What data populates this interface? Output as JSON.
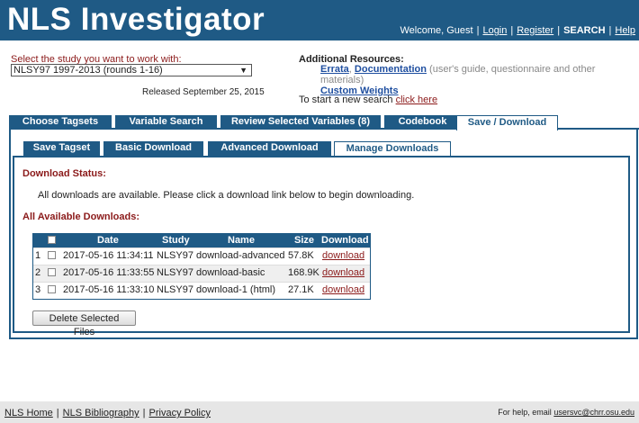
{
  "header": {
    "logo": "NLS Investigator",
    "welcome": "Welcome, Guest",
    "links": {
      "login": "Login",
      "register": "Register",
      "search": "SEARCH",
      "help": "Help"
    }
  },
  "study": {
    "label": "Select the study you want to work with:",
    "selected": "NLSY97 1997-2013 (rounds 1-16)",
    "released": "Released September 25, 2015"
  },
  "resources": {
    "title": "Additional Resources:",
    "errata": "Errata",
    "documentation": "Documentation",
    "doc_note": "(user's guide, questionnaire and other materials)",
    "custom_weights": "Custom Weights",
    "new_search_text": "To start a new search ",
    "new_search_link": "click here"
  },
  "tabs": [
    "Choose Tagsets",
    "Variable Search",
    "Review Selected Variables (8)",
    "Codebook",
    "Save / Download"
  ],
  "subtabs": [
    "Save Tagset",
    "Basic Download",
    "Advanced Download",
    "Manage Downloads"
  ],
  "status": {
    "heading": "Download Status:",
    "message": "All downloads are available. Please click a download link below to begin downloading.",
    "all_heading": "All Available Downloads:"
  },
  "table": {
    "headers": {
      "date": "Date",
      "study": "Study",
      "name": "Name",
      "size": "Size",
      "download": "Download"
    },
    "rows": [
      {
        "num": "1",
        "date": "2017-05-16 11:34:11",
        "study": "NLSY97",
        "name": "download-advanced",
        "size": "57.8K",
        "link": "download"
      },
      {
        "num": "2",
        "date": "2017-05-16 11:33:55",
        "study": "NLSY97",
        "name": "download-basic",
        "size": "168.9K",
        "link": "download"
      },
      {
        "num": "3",
        "date": "2017-05-16 11:33:10",
        "study": "NLSY97",
        "name": "download-1 (html)",
        "size": "27.1K",
        "link": "download"
      }
    ]
  },
  "delete_button": "Delete Selected Files",
  "footer": {
    "home": "NLS Home",
    "bibliography": "NLS Bibliography",
    "privacy": "Privacy Policy",
    "help_text": "For help, email ",
    "help_email": "usersvc@chrr.osu.edu"
  },
  "colors": {
    "brand": "#1f5a85",
    "accent": "#8b1a1a"
  }
}
